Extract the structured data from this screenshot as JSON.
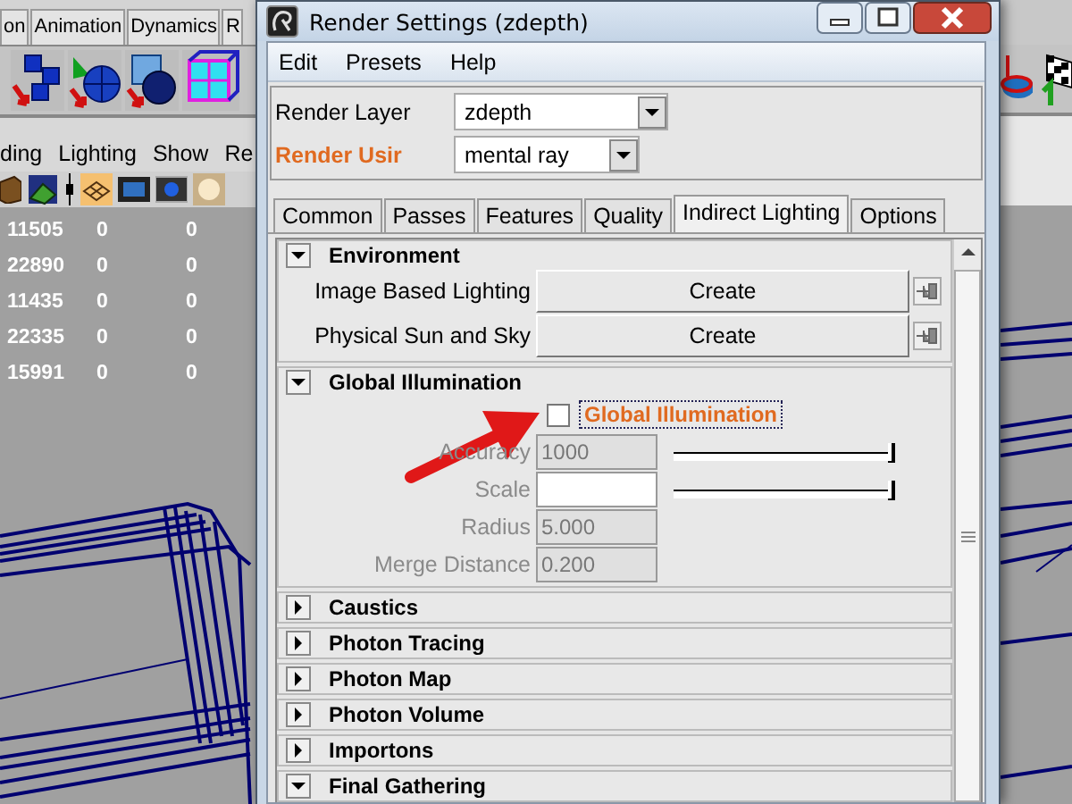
{
  "background_app": {
    "shelf_tabs": [
      {
        "label": "on",
        "selected": false
      },
      {
        "label": "Animation",
        "selected": false
      },
      {
        "label": "Dynamics",
        "selected": false
      },
      {
        "label": "R",
        "selected": false
      }
    ],
    "panel_menu": [
      "ding",
      "Lighting",
      "Show",
      "Re"
    ],
    "stats_rows": [
      [
        "11505",
        "0",
        "0"
      ],
      [
        "22890",
        "0",
        "0"
      ],
      [
        "11435",
        "0",
        "0"
      ],
      [
        "22335",
        "0",
        "0"
      ],
      [
        "15991",
        "0",
        "0"
      ]
    ]
  },
  "window": {
    "title": "Render Settings (zdepth)"
  },
  "menu": [
    "Edit",
    "Presets",
    "Help"
  ],
  "render_layer": {
    "label": "Render Layer",
    "value": "zdepth",
    "highlighted": false
  },
  "render_using": {
    "label": "Render Usir",
    "value": "mental ray",
    "highlighted": true
  },
  "tabs": [
    {
      "label": "Common",
      "selected": false
    },
    {
      "label": "Passes",
      "selected": false
    },
    {
      "label": "Features",
      "selected": false
    },
    {
      "label": "Quality",
      "selected": false
    },
    {
      "label": "Indirect Lighting",
      "selected": true
    },
    {
      "label": "Options",
      "selected": false
    }
  ],
  "sections": [
    {
      "title": "Environment",
      "expanded": true,
      "rows": [
        {
          "kind": "button",
          "label": "Image Based Lighting",
          "button": "Create"
        },
        {
          "kind": "button",
          "label": "Physical Sun and Sky",
          "button": "Create"
        }
      ]
    },
    {
      "title": "Global Illumination",
      "expanded": true,
      "rows": [
        {
          "kind": "checkbox",
          "label": "Global Illumination",
          "checked": false,
          "highlighted": true
        },
        {
          "kind": "slider",
          "label": "Accuracy",
          "disabled": true,
          "field": {
            "value": "1000",
            "disabled": true
          },
          "level": 1
        },
        {
          "kind": "slider",
          "label": "Scale",
          "disabled": true,
          "field": {
            "disabled": false
          },
          "level": 1
        },
        {
          "kind": "field",
          "label": "Radius",
          "disabled": true,
          "field": {
            "value": "5.000",
            "disabled": true
          }
        },
        {
          "kind": "field",
          "label": "Merge Distance",
          "disabled": true,
          "field": {
            "value": "0.200",
            "disabled": true
          }
        }
      ]
    },
    {
      "title": "Caustics",
      "expanded": false
    },
    {
      "title": "Photon Tracing",
      "expanded": false
    },
    {
      "title": "Photon Map",
      "expanded": false
    },
    {
      "title": "Photon Volume",
      "expanded": false
    },
    {
      "title": "Importons",
      "expanded": false
    },
    {
      "title": "Final Gathering",
      "expanded": true
    }
  ]
}
